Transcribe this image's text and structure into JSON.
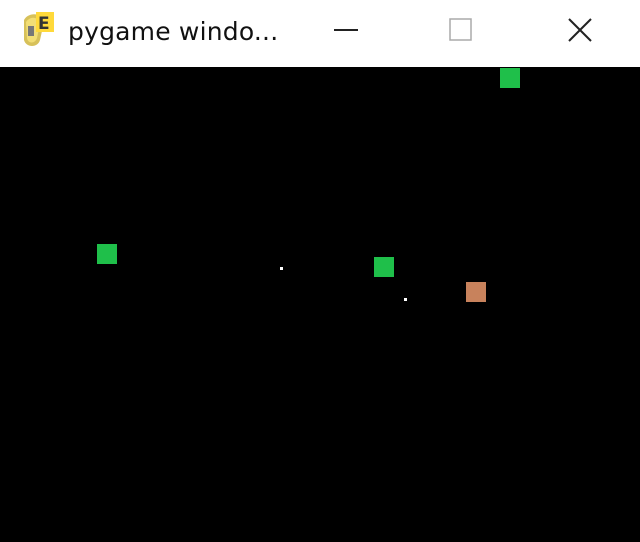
{
  "window": {
    "title": "pygame windo...",
    "icon": "pygame-snake-icon",
    "controls": [
      "minimize-icon",
      "maximize-icon",
      "close-icon"
    ]
  },
  "game": {
    "background_color": "#000000",
    "food_color": "#1fbf4a",
    "enemy_color": "#c8825c",
    "projectile_color": "#ffffff"
  }
}
